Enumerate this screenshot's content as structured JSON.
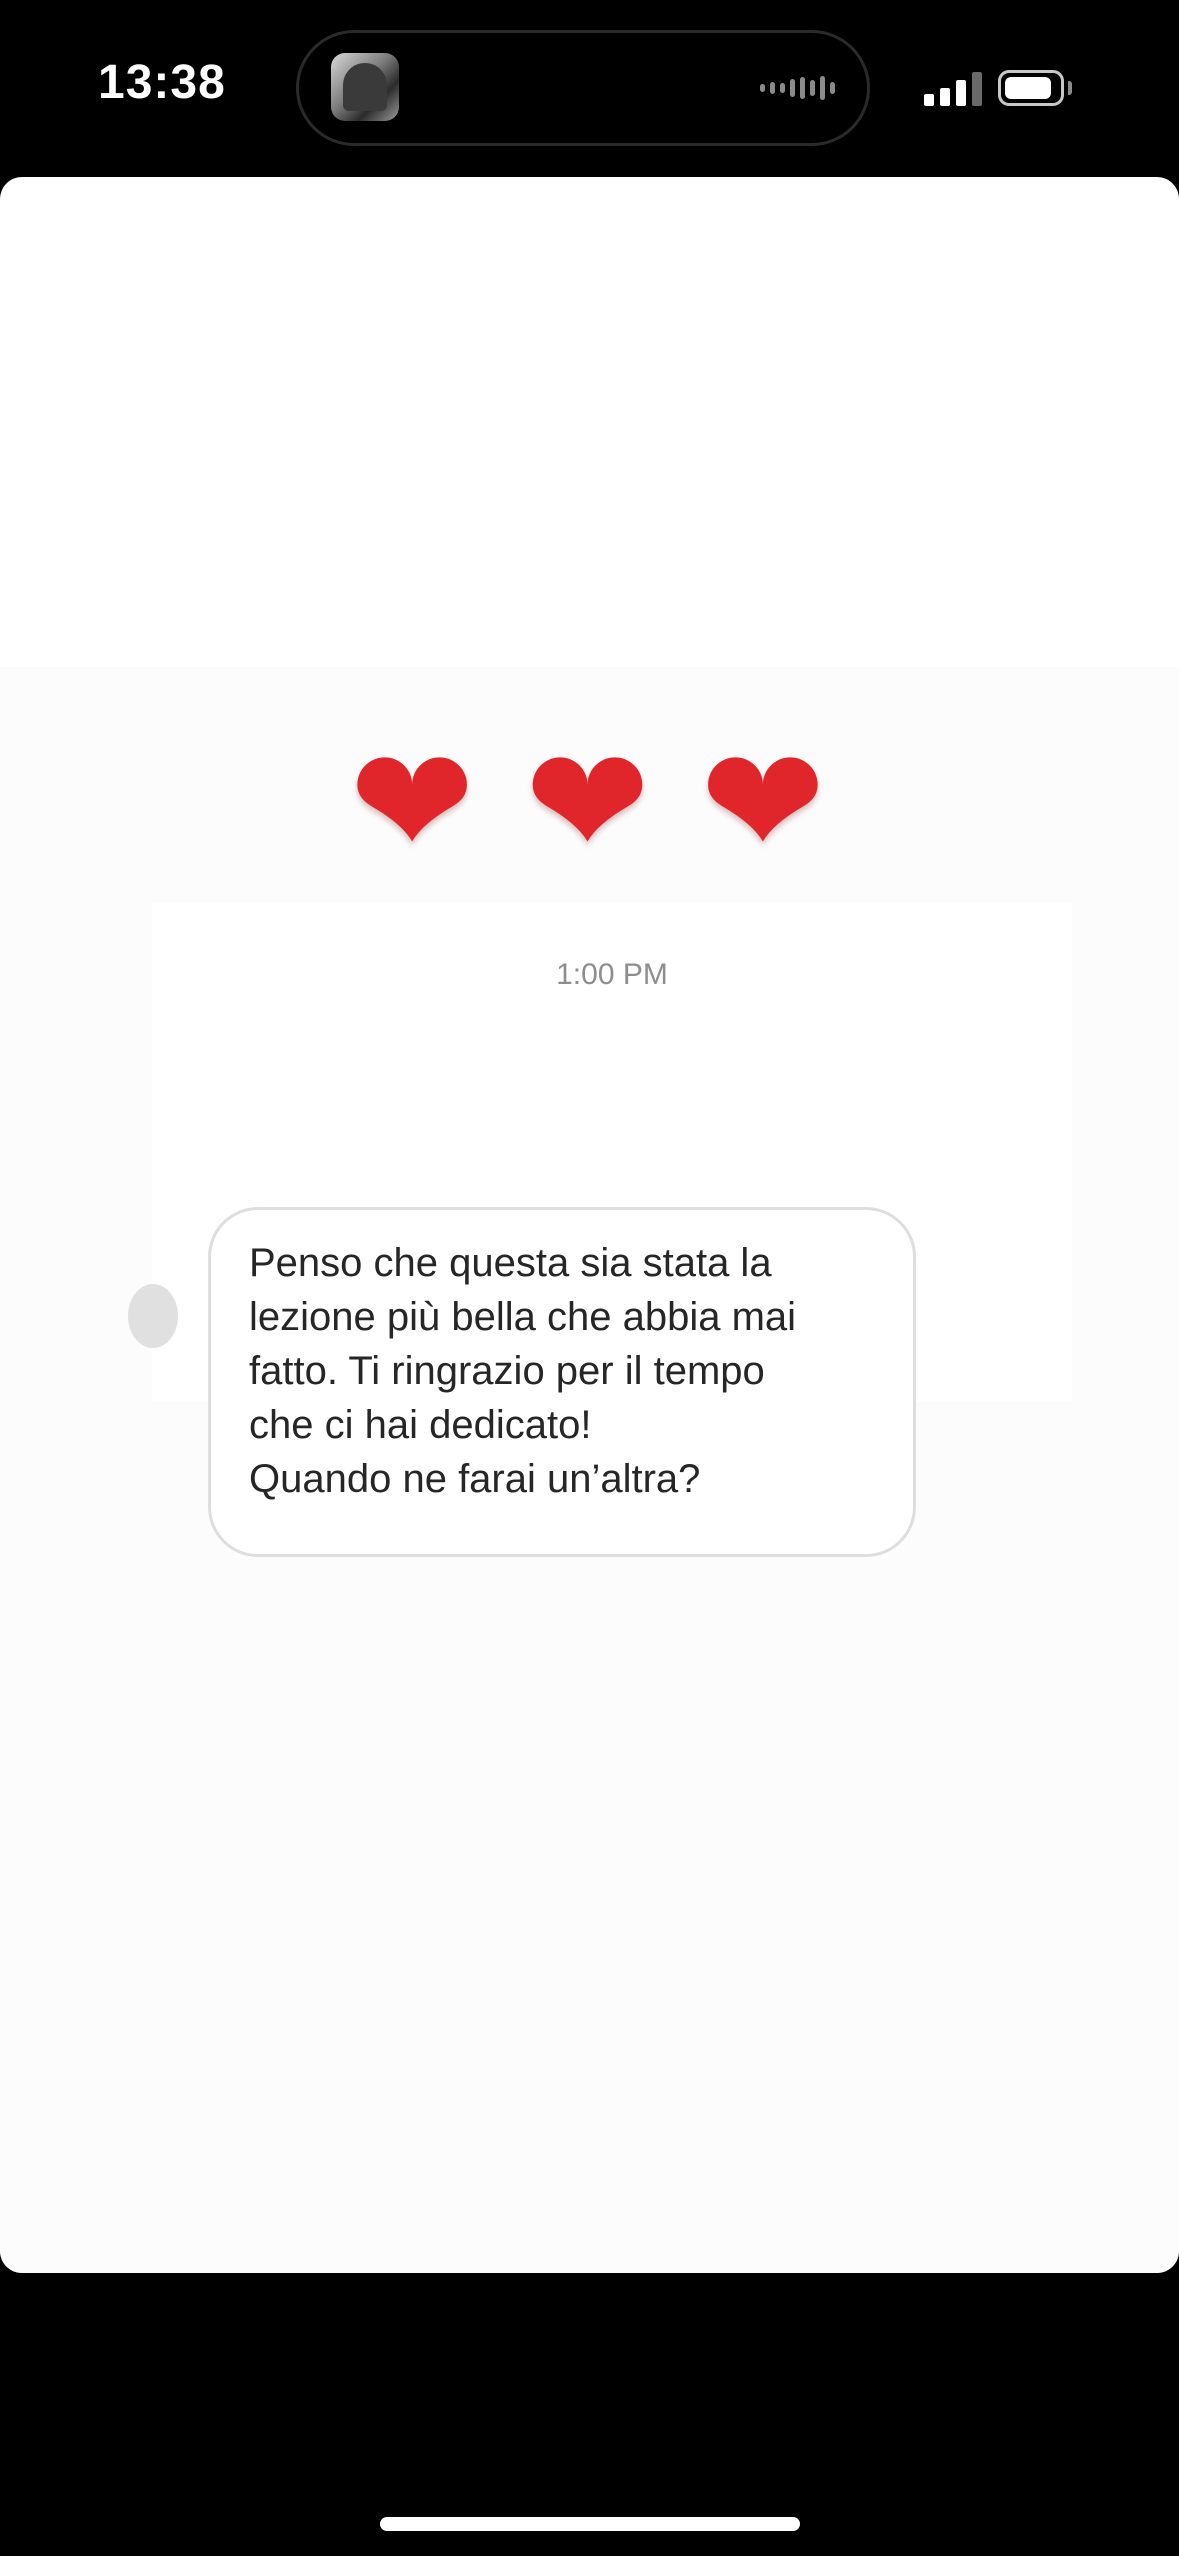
{
  "status_bar": {
    "time": "13:38"
  },
  "story": {
    "hearts": [
      "❤",
      "❤",
      "❤"
    ],
    "message": {
      "timestamp": "1:00 PM",
      "text": "Penso che questa sia stata la\nlezione più bella che abbia mai\nfatto. Ti ringrazio per il tempo\nche ci hai dedicato!\nQuando ne farai un’altra?"
    }
  },
  "colors": {
    "heart": "#e0262a",
    "bubble_border": "#dedede",
    "text": "#262626",
    "timestamp": "#8e8e8e"
  }
}
